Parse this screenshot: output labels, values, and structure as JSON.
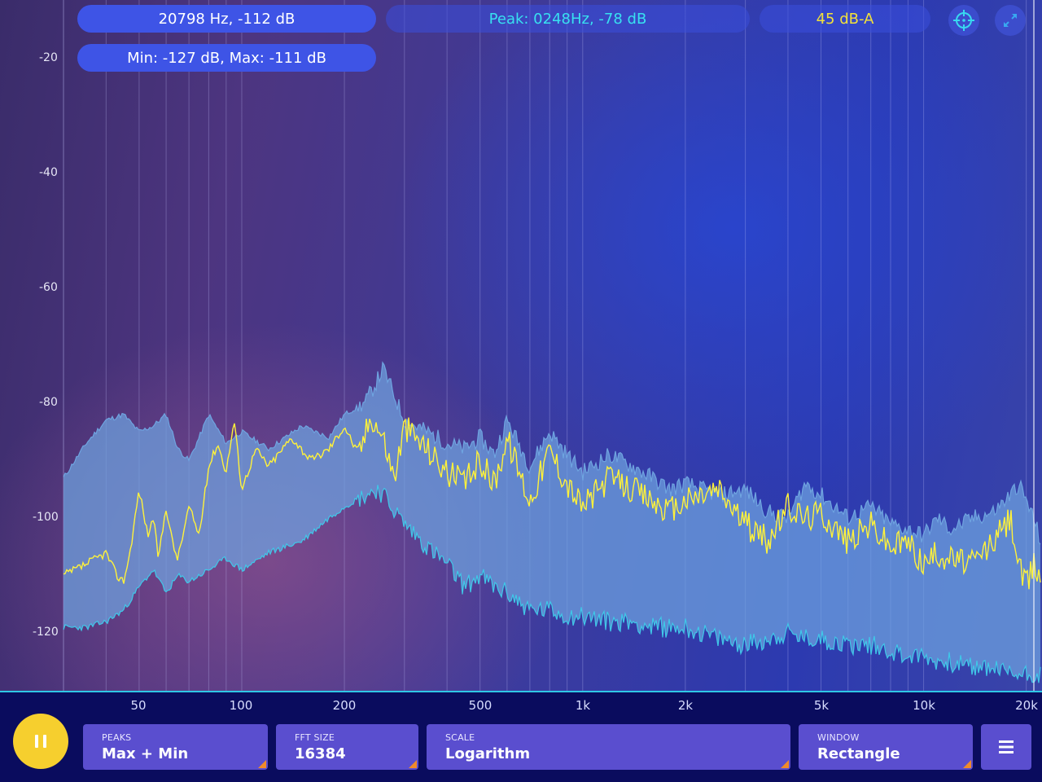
{
  "readouts": {
    "cursor": "20798 Hz, -112 dB",
    "peak": "Peak: 0248Hz, -78 dB",
    "level": "45 dB-A",
    "minmax": "Min: -127 dB, Max: -111 dB"
  },
  "icons": {
    "target": "crosshair-target-icon",
    "expand": "expand-arrows-icon",
    "pause": "pause-icon",
    "menu": "hamburger-menu-icon"
  },
  "controls": {
    "peaks": {
      "label": "PEAKS",
      "value": "Max + Min"
    },
    "fft_size": {
      "label": "FFT SIZE",
      "value": "16384"
    },
    "scale": {
      "label": "SCALE",
      "value": "Logarithm"
    },
    "window": {
      "label": "WINDOW",
      "value": "Rectangle"
    }
  },
  "colors": {
    "accent_yellow": "#f4d03a",
    "accent_cyan": "#2fc7e6",
    "control_bg": "#5a4ecf",
    "peak_text": "#38e0f0",
    "level_text": "#f2e13a",
    "current_line": "#fff23a",
    "band_fill": "#6fa4e0",
    "min_line": "#3fc8e8"
  },
  "chart_data": {
    "type": "area",
    "xscale": "log",
    "xlim": [
      30,
      22000
    ],
    "ylim": [
      -130,
      -10
    ],
    "x_tick_labels": [
      {
        "value": 50,
        "label": "50"
      },
      {
        "value": 100,
        "label": "100"
      },
      {
        "value": 200,
        "label": "200"
      },
      {
        "value": 500,
        "label": "500"
      },
      {
        "value": 1000,
        "label": "1k"
      },
      {
        "value": 2000,
        "label": "2k"
      },
      {
        "value": 5000,
        "label": "5k"
      },
      {
        "value": 10000,
        "label": "10k"
      },
      {
        "value": 20000,
        "label": "20k"
      }
    ],
    "y_tick_labels": [
      {
        "value": -20,
        "label": "-20"
      },
      {
        "value": -40,
        "label": "-40"
      },
      {
        "value": -60,
        "label": "-60"
      },
      {
        "value": -80,
        "label": "-80"
      },
      {
        "value": -100,
        "label": "-100"
      },
      {
        "value": -120,
        "label": "-120"
      }
    ],
    "grid": true,
    "series": [
      {
        "role": "max",
        "x": [
          30,
          35,
          40,
          45,
          50,
          55,
          60,
          65,
          70,
          75,
          80,
          90,
          100,
          120,
          150,
          180,
          200,
          230,
          250,
          260,
          300,
          350,
          400,
          450,
          500,
          550,
          600,
          700,
          800,
          900,
          1000,
          1200,
          1400,
          1600,
          1800,
          2000,
          2500,
          3000,
          3500,
          4000,
          4500,
          5000,
          6000,
          7000,
          8000,
          9000,
          10000,
          11000,
          12000,
          14000,
          16000,
          18000,
          19000,
          20000,
          21000,
          22000
        ],
        "y": [
          -93,
          -87,
          -83,
          -82,
          -85,
          -84,
          -82,
          -88,
          -90,
          -86,
          -82,
          -87,
          -85,
          -88,
          -84,
          -86,
          -82,
          -80,
          -76,
          -74,
          -83,
          -85,
          -87,
          -88,
          -86,
          -89,
          -83,
          -91,
          -85,
          -89,
          -92,
          -89,
          -91,
          -93,
          -95,
          -94,
          -96,
          -95,
          -99,
          -100,
          -94,
          -96,
          -100,
          -98,
          -101,
          -102,
          -103,
          -100,
          -102,
          -100,
          -99,
          -96,
          -94,
          -97,
          -100,
          -104
        ]
      },
      {
        "role": "min",
        "x": [
          30,
          35,
          40,
          45,
          50,
          55,
          60,
          65,
          70,
          75,
          80,
          90,
          100,
          120,
          150,
          180,
          200,
          230,
          250,
          260,
          300,
          350,
          400,
          450,
          500,
          550,
          600,
          700,
          800,
          900,
          1000,
          1200,
          1400,
          1600,
          1800,
          2000,
          2500,
          3000,
          3500,
          4000,
          4500,
          5000,
          6000,
          7000,
          8000,
          9000,
          10000,
          11000,
          12000,
          14000,
          16000,
          18000,
          19000,
          20000,
          21000,
          22000
        ],
        "y": [
          -119,
          -119,
          -118,
          -116,
          -112,
          -109,
          -113,
          -110,
          -111,
          -110,
          -109,
          -107,
          -109,
          -106,
          -104,
          -100,
          -98,
          -96,
          -95,
          -96,
          -101,
          -105,
          -108,
          -112,
          -110,
          -112,
          -113,
          -116,
          -116,
          -117,
          -117,
          -118,
          -118,
          -119,
          -119,
          -119,
          -121,
          -122,
          -121,
          -120,
          -121,
          -121,
          -122,
          -122,
          -123,
          -124,
          -124,
          -125,
          -125,
          -126,
          -126,
          -127,
          -127,
          -127,
          -127,
          -127
        ]
      },
      {
        "role": "current",
        "x": [
          30,
          35,
          40,
          43,
          45,
          47,
          50,
          53,
          55,
          57,
          60,
          63,
          65,
          70,
          75,
          80,
          85,
          90,
          95,
          100,
          110,
          120,
          140,
          160,
          180,
          200,
          220,
          240,
          260,
          280,
          300,
          350,
          400,
          450,
          500,
          550,
          600,
          700,
          800,
          900,
          1000,
          1200,
          1400,
          1600,
          1800,
          2000,
          2500,
          3000,
          3500,
          4000,
          4500,
          5000,
          6000,
          7000,
          8000,
          9000,
          10000,
          11000,
          12000,
          14000,
          16000,
          18000,
          19000,
          20000,
          21000,
          22000
        ],
        "y": [
          -110,
          -108,
          -106,
          -110,
          -111,
          -106,
          -95,
          -103,
          -100,
          -107,
          -98,
          -105,
          -107,
          -98,
          -103,
          -91,
          -87,
          -92,
          -83,
          -95,
          -88,
          -91,
          -86,
          -90,
          -88,
          -84,
          -89,
          -82,
          -86,
          -93,
          -84,
          -88,
          -92,
          -94,
          -90,
          -94,
          -86,
          -97,
          -88,
          -94,
          -98,
          -93,
          -95,
          -97,
          -99,
          -97,
          -95,
          -101,
          -104,
          -98,
          -100,
          -99,
          -104,
          -101,
          -105,
          -104,
          -108,
          -106,
          -107,
          -108,
          -104,
          -100,
          -108,
          -112,
          -108,
          -110
        ]
      }
    ]
  }
}
